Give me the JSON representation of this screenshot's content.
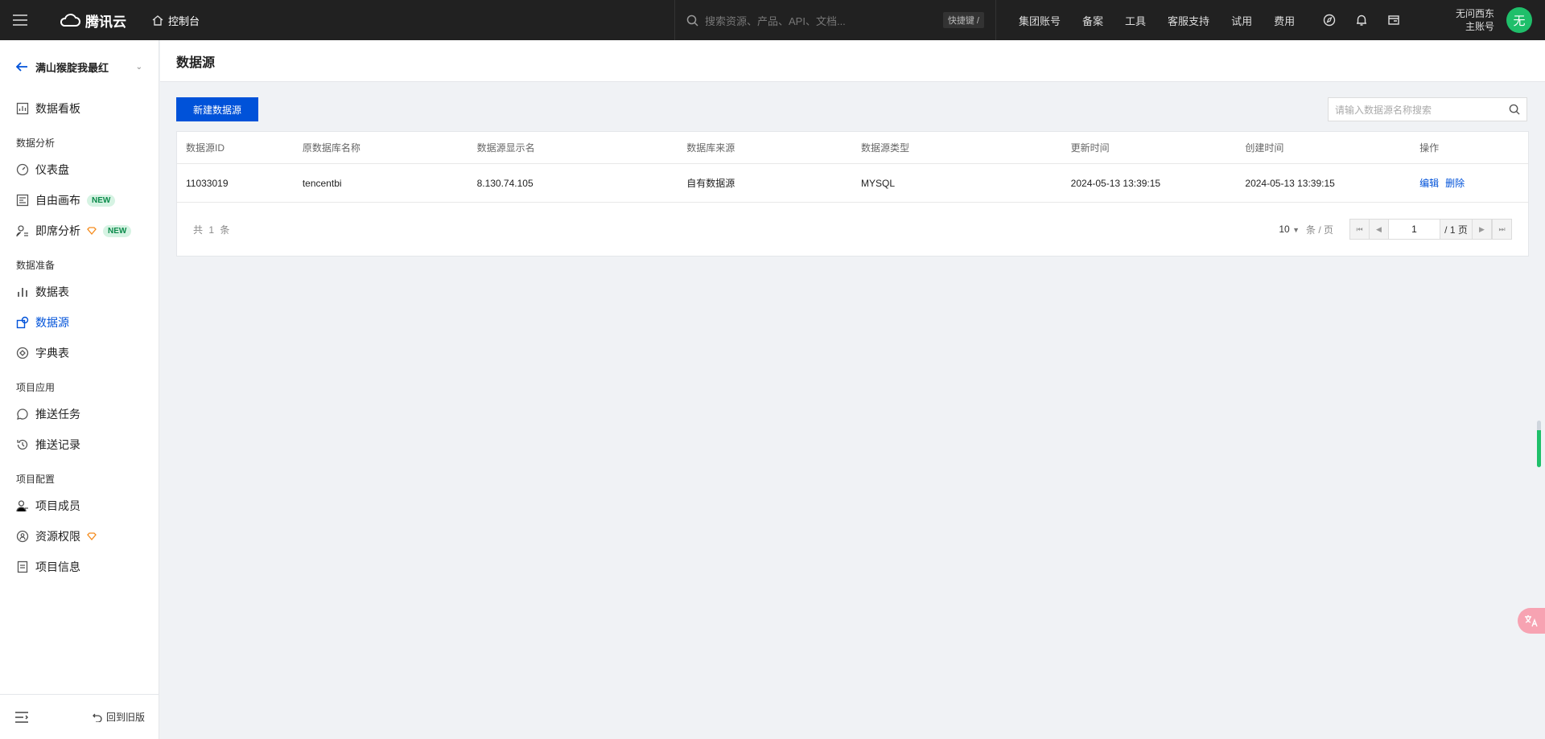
{
  "topbar": {
    "brand": "腾讯云",
    "console": "控制台",
    "search_placeholder": "搜索资源、产品、API、文档...",
    "shortcut": "快捷键 /",
    "nav": [
      "集团账号",
      "备案",
      "工具",
      "客服支持",
      "试用",
      "费用"
    ],
    "user_name": "无问西东",
    "user_role": "主账号",
    "avatar_char": "无"
  },
  "sidebar": {
    "project_name": "满山猴腚我最红",
    "dashboard": "数据看板",
    "groups": {
      "analysis": "数据分析",
      "prep": "数据准备",
      "app": "项目应用",
      "config": "项目配置"
    },
    "items": {
      "yibiaopan": "仪表盘",
      "ziyou": "自由画布",
      "jixi": "即席分析",
      "shujubiao": "数据表",
      "shujuyuan": "数据源",
      "zidian": "字典表",
      "tuisong_renwu": "推送任务",
      "tuisong_jilu": "推送记录",
      "chengyuan": "项目成员",
      "quanxian": "资源权限",
      "xinxi": "项目信息"
    },
    "new_badge": "NEW",
    "back_old": "回到旧版"
  },
  "page": {
    "title": "数据源",
    "new_button": "新建数据源",
    "search_placeholder": "请输入数据源名称搜索"
  },
  "table": {
    "columns": [
      "数据源ID",
      "原数据库名称",
      "数据源显示名",
      "数据库来源",
      "数据源类型",
      "更新时间",
      "创建时间",
      "操作"
    ],
    "rows": [
      {
        "id": "11033019",
        "db_name": "tencentbi",
        "display_name": "8.130.74.105",
        "source": "自有数据源",
        "type": "MYSQL",
        "updated": "2024-05-13 13:39:15",
        "created": "2024-05-13 13:39:15",
        "edit": "编辑",
        "delete": "删除"
      }
    ]
  },
  "pagination": {
    "total": "共 1 条",
    "page_size": "10",
    "unit": "条 / 页",
    "current": "1",
    "of_pages": "/ 1 页"
  },
  "colors": {
    "primary": "#0052d9",
    "topbar_bg": "#212121",
    "avatar": "#1fbf6a"
  }
}
